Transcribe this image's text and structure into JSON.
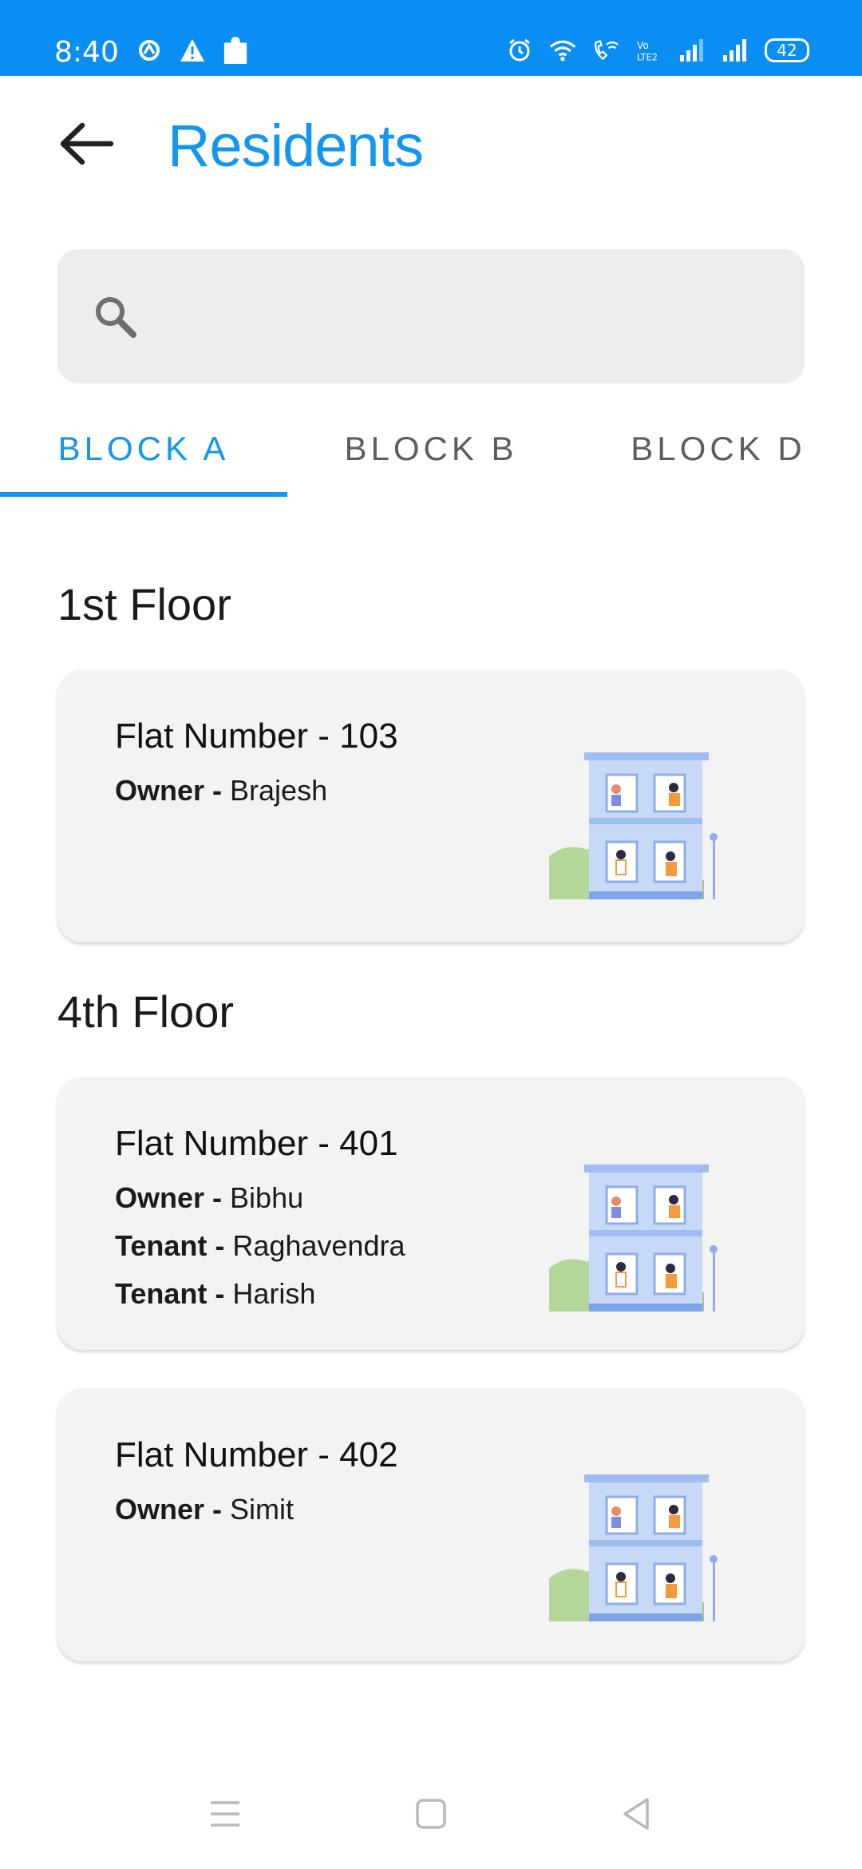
{
  "status_bar": {
    "time": "8:40",
    "battery": "42",
    "left_icons": [
      "data-saver-icon",
      "warning-icon",
      "puzzle-icon"
    ],
    "right_icons": [
      "alarm-icon",
      "wifi-icon",
      "wifi-calling-icon",
      "volte-icon",
      "signal-icon",
      "signal-icon"
    ],
    "background": "#0a8ef3"
  },
  "header": {
    "title": "Residents",
    "back_icon": "arrow-left-icon",
    "title_color": "#1296f0"
  },
  "search": {
    "placeholder": "",
    "value": "",
    "icon": "search-icon"
  },
  "tabs": [
    {
      "label": "BLOCK A",
      "active": true
    },
    {
      "label": "BLOCK B",
      "active": false
    },
    {
      "label": "BLOCK D",
      "active": false
    }
  ],
  "floors": [
    {
      "name": "1st Floor",
      "flats": [
        {
          "flat_label": "Flat Number - 103",
          "residents": [
            {
              "role": "Owner - ",
              "name": "Brajesh"
            }
          ]
        }
      ]
    },
    {
      "name": "4th Floor",
      "flats": [
        {
          "flat_label": "Flat Number - 401",
          "residents": [
            {
              "role": "Owner - ",
              "name": "Bibhu"
            },
            {
              "role": "Tenant - ",
              "name": "Raghavendra"
            },
            {
              "role": "Tenant - ",
              "name": "Harish"
            }
          ]
        },
        {
          "flat_label": "Flat Number - 402",
          "residents": [
            {
              "role": "Owner - ",
              "name": "Simit"
            }
          ]
        }
      ]
    }
  ],
  "nav_bar": {
    "buttons": [
      "menu-icon",
      "home-square-icon",
      "back-triangle-icon"
    ]
  }
}
